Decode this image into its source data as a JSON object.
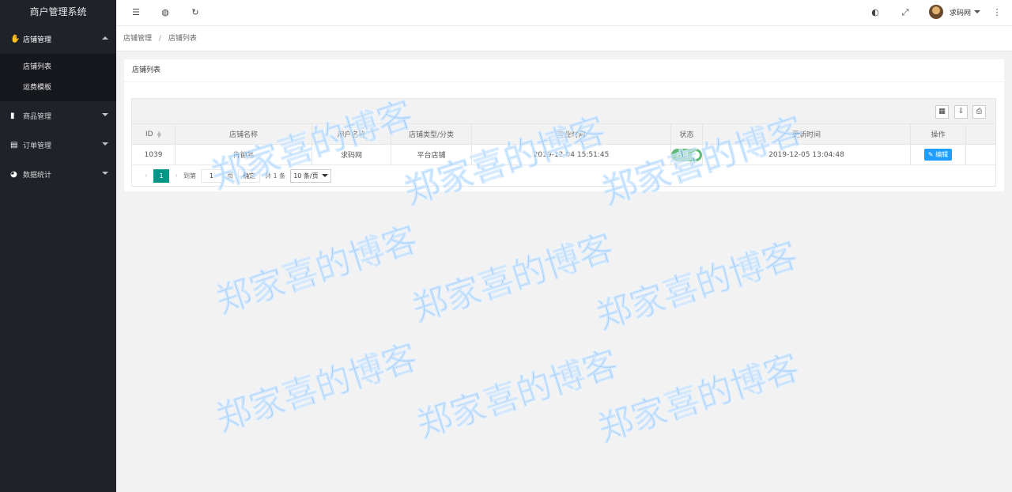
{
  "app_title": "商户管理系统",
  "sidebar": {
    "menus": [
      {
        "label": "店铺管理",
        "icon": "hand-icon",
        "expanded": true
      },
      {
        "label": "商品管理",
        "icon": "bar-chart-icon",
        "expanded": false
      },
      {
        "label": "订单管理",
        "icon": "calendar-icon",
        "expanded": false
      },
      {
        "label": "数据统计",
        "icon": "pie-chart-icon",
        "expanded": false
      }
    ],
    "submenu": [
      "店铺列表",
      "运费模板"
    ]
  },
  "header": {
    "user_name": "求码网"
  },
  "breadcrumb": {
    "parent": "店铺管理",
    "separator": "/",
    "current": "店铺列表"
  },
  "card": {
    "title": "店铺列表"
  },
  "table": {
    "columns": [
      "ID",
      "店铺名称",
      "用户名称",
      "店铺类型/分类",
      "营业时间",
      "状态",
      "更新时间",
      "操作"
    ],
    "rows": [
      {
        "id": "1039",
        "shop_name": "肯德基",
        "user_name": "求码网",
        "type": "平台店铺",
        "open_time": "2019-12-04 15:51:45",
        "status": "启用",
        "updated": "2019-12-05 13:04:48",
        "action": "编辑"
      }
    ]
  },
  "pager": {
    "current_page": "1",
    "goto_label": "到第",
    "goto_value": "1",
    "page_unit": "页",
    "confirm_label": "确定",
    "total_text": "共 1 条",
    "page_size": "10 条/页"
  },
  "watermark_text": "郑家喜的博客",
  "colors": {
    "sidebar_bg": "#20222a",
    "submenu_bg": "#17181e",
    "primary": "#009688",
    "switch_on": "#5fb878",
    "edit_button": "#1e9fff"
  }
}
